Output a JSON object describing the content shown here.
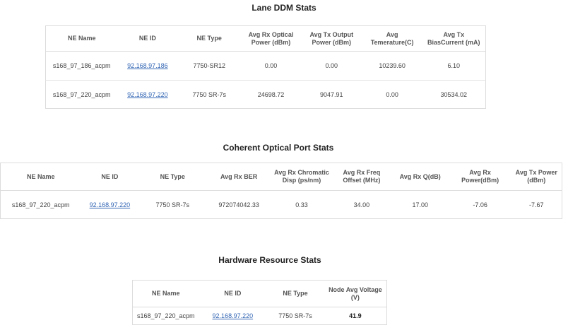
{
  "lane_ddm": {
    "title": "Lane DDM Stats",
    "headers": [
      "NE Name",
      "NE ID",
      "NE Type",
      "Avg Rx Optical Power (dBm)",
      "Avg Tx Output Power (dBm)",
      "Avg Temerature(C)",
      "Avg Tx BiasCurrent (mA)"
    ],
    "rows": [
      [
        "s168_97_186_acpm",
        "92.168.97.186",
        "7750-SR12",
        "0.00",
        "0.00",
        "10239.60",
        "6.10"
      ],
      [
        "s168_97_220_acpm",
        "92.168.97.220",
        "7750 SR-7s",
        "24698.72",
        "9047.91",
        "0.00",
        "30534.02"
      ]
    ]
  },
  "coherent": {
    "title": "Coherent Optical Port Stats",
    "headers": [
      "NE Name",
      "NE ID",
      "NE Type",
      "Avg Rx BER",
      "Avg Rx Chromatic Disp (ps/nm)",
      "Avg Rx Freq Offset (MHz)",
      "Avg Rx Q(dB)",
      "Avg Rx Power(dBm)",
      "Avg Tx Power (dBm)"
    ],
    "rows": [
      [
        "s168_97_220_acpm",
        "92.168.97.220",
        "7750 SR-7s",
        "972074042.33",
        "0.33",
        "34.00",
        "17.00",
        "-7.06",
        "-7.67"
      ]
    ]
  },
  "hardware": {
    "title": "Hardware Resource Stats",
    "headers": [
      "NE Name",
      "NE ID",
      "NE Type",
      "Node Avg Voltage (V)"
    ],
    "rows": [
      [
        "s168_97_220_acpm",
        "92.168.97.220",
        "7750 SR-7s",
        "41.9"
      ]
    ]
  }
}
